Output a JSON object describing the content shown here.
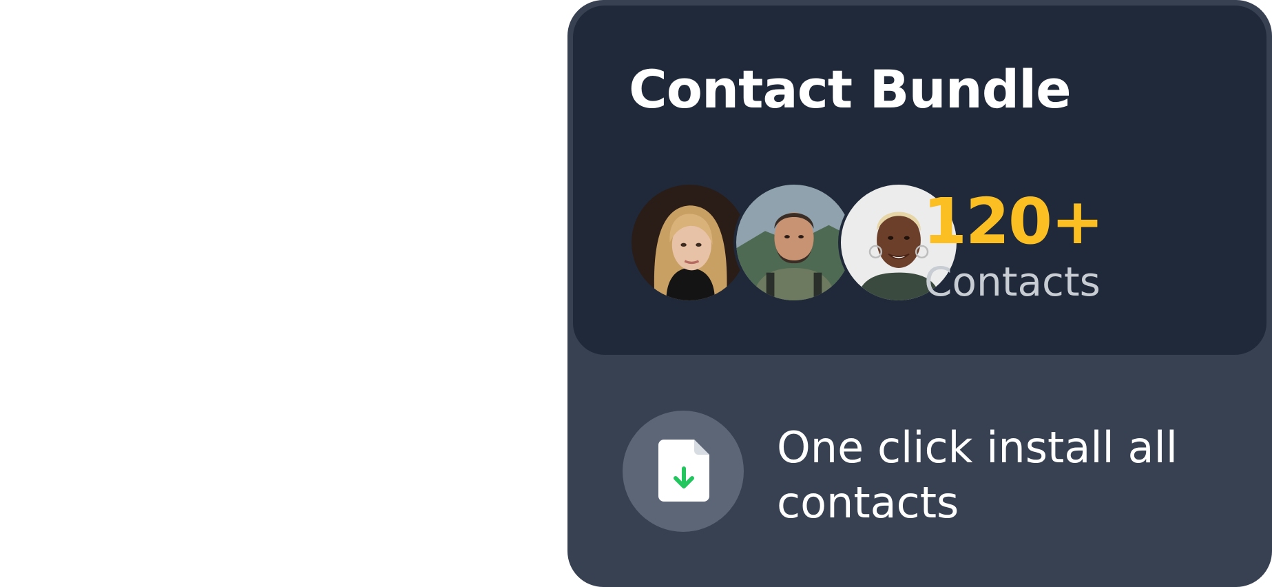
{
  "card": {
    "title": "Contact Bundle",
    "count": "120+",
    "count_label": "Contacts",
    "install_text": "One click install all contacts"
  },
  "avatars": [
    {
      "name": "avatar-woman-blonde"
    },
    {
      "name": "avatar-man-beard"
    },
    {
      "name": "avatar-woman-short-hair"
    }
  ],
  "icons": {
    "install": "file-download-icon"
  },
  "colors": {
    "card_bg": "#384152",
    "panel_bg": "#202939",
    "accent": "#fbbf24",
    "icon_arrow": "#22c55e",
    "icon_circle": "#5c6677"
  }
}
